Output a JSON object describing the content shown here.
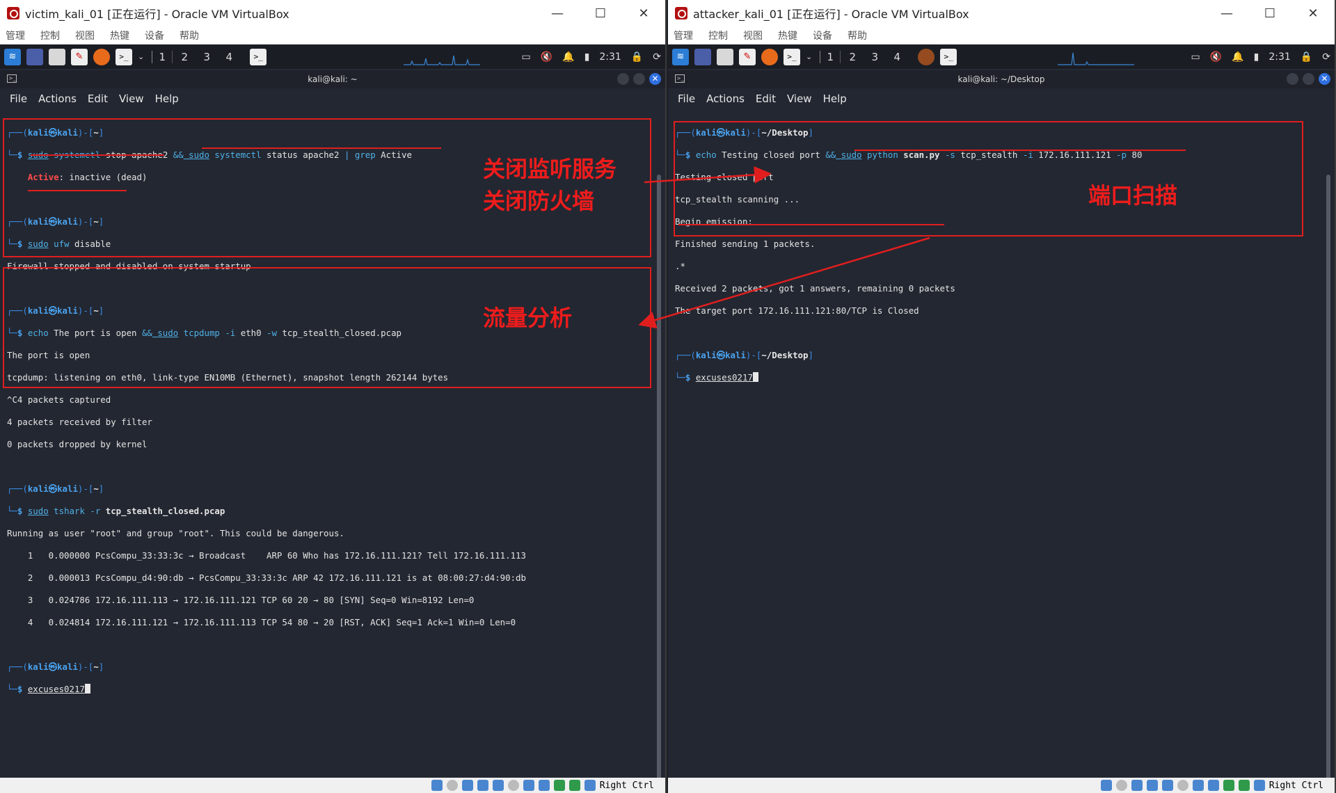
{
  "left": {
    "vb_title": "victim_kali_01 [正在运行] - Oracle VM VirtualBox",
    "vb_menu": [
      "管理",
      "控制",
      "视图",
      "热键",
      "设备",
      "帮助"
    ],
    "workspaces": [
      "1",
      "2",
      "3",
      "4"
    ],
    "clock": "2:31",
    "term_title": "kali@kali: ~",
    "term_menu": [
      "File",
      "Actions",
      "Edit",
      "View",
      "Help"
    ],
    "status_label": "Right Ctrl",
    "lines": {
      "p1_user": "kali",
      "p1_host": "kali",
      "p1_dir": "~",
      "cmd1_a": "sudo",
      "cmd1_b": " systemctl",
      "cmd1_c": " stop apache2 ",
      "cmd1_amp": "&&",
      "cmd1_d": " sudo",
      "cmd1_e": " systemctl",
      "cmd1_f": " status apache2 ",
      "cmd1_pipe": "|",
      "cmd1_g": " grep",
      "cmd1_h": " Active",
      "out1_active": "Active",
      "out1_rest": ": inactive (dead)",
      "cmd2_a": "sudo",
      "cmd2_b": " ufw",
      "cmd2_c": " disable",
      "out2": "Firewall stopped and disabled on system startup",
      "cmd3_a": "echo",
      "cmd3_b": " The port is open ",
      "cmd3_amp": "&&",
      "cmd3_c": " sudo",
      "cmd3_d": " tcpdump",
      "cmd3_e": " -i",
      "cmd3_f": " eth0 ",
      "cmd3_g": "-w",
      "cmd3_h": " tcp_stealth_closed.pcap",
      "out3_1": "The port is open",
      "out3_2": "tcpdump: listening on eth0, link-type EN10MB (Ethernet), snapshot length 262144 bytes",
      "out3_3": "^C4 packets captured",
      "out3_4": "4 packets received by filter",
      "out3_5": "0 packets dropped by kernel",
      "cmd4_a": "sudo",
      "cmd4_b": " tshark",
      "cmd4_c": " -r",
      "cmd4_d": " tcp_stealth_closed.pcap",
      "out4_0": "Running as user \"root\" and group \"root\". This could be dangerous.",
      "out4_1": "    1   0.000000 PcsCompu_33:33:3c → Broadcast    ARP 60 Who has 172.16.111.121? Tell 172.16.111.113",
      "out4_2": "    2   0.000013 PcsCompu_d4:90:db → PcsCompu_33:33:3c ARP 42 172.16.111.121 is at 08:00:27:d4:90:db",
      "out4_3": "    3   0.024786 172.16.111.113 → 172.16.111.121 TCP 60 20 → 80 [SYN] Seq=0 Win=8192 Len=0",
      "out4_4": "    4   0.024814 172.16.111.121 → 172.16.111.113 TCP 54 80 → 20 [RST, ACK] Seq=1 Ack=1 Win=0 Len=0",
      "cmd5": "excuses0217"
    },
    "annotations": {
      "a1_line1": "关闭监听服务",
      "a1_line2": "关闭防火墙",
      "a2": "流量分析"
    }
  },
  "right": {
    "vb_title": "attacker_kali_01 [正在运行] - Oracle VM VirtualBox",
    "vb_menu": [
      "管理",
      "控制",
      "视图",
      "热键",
      "设备",
      "帮助"
    ],
    "workspaces": [
      "1",
      "2",
      "3",
      "4"
    ],
    "clock": "2:31",
    "term_title": "kali@kali: ~/Desktop",
    "term_menu": [
      "File",
      "Actions",
      "Edit",
      "View",
      "Help"
    ],
    "status_label": "Right Ctrl",
    "lines": {
      "p_dir": "~/Desktop",
      "cmd1_a": "echo",
      "cmd1_b": " Testing closed port ",
      "cmd1_amp": "&&",
      "cmd1_c": " sudo",
      "cmd1_d": " python",
      "cmd1_e": " scan.py",
      "cmd1_f": " -s",
      "cmd1_g": " tcp_stealth ",
      "cmd1_h": "-i",
      "cmd1_i": " 172.16.111.121 ",
      "cmd1_j": "-p",
      "cmd1_k": " 80",
      "out1": "Testing closed port",
      "out2": "tcp_stealth scanning ...",
      "out3": "Begin emission:",
      "out4": "Finished sending 1 packets.",
      "out5": ".*",
      "out6": "Received 2 packets, got 1 answers, remaining 0 packets",
      "out7": "The target port 172.16.111.121:80/TCP is Closed",
      "cmd2": "excuses0217"
    },
    "annotations": {
      "a1": "端口扫描"
    }
  },
  "colors": {
    "annotation_red": "#e01e1e",
    "prompt_blue": "#3b8eea",
    "terminal_bg": "#232731"
  }
}
